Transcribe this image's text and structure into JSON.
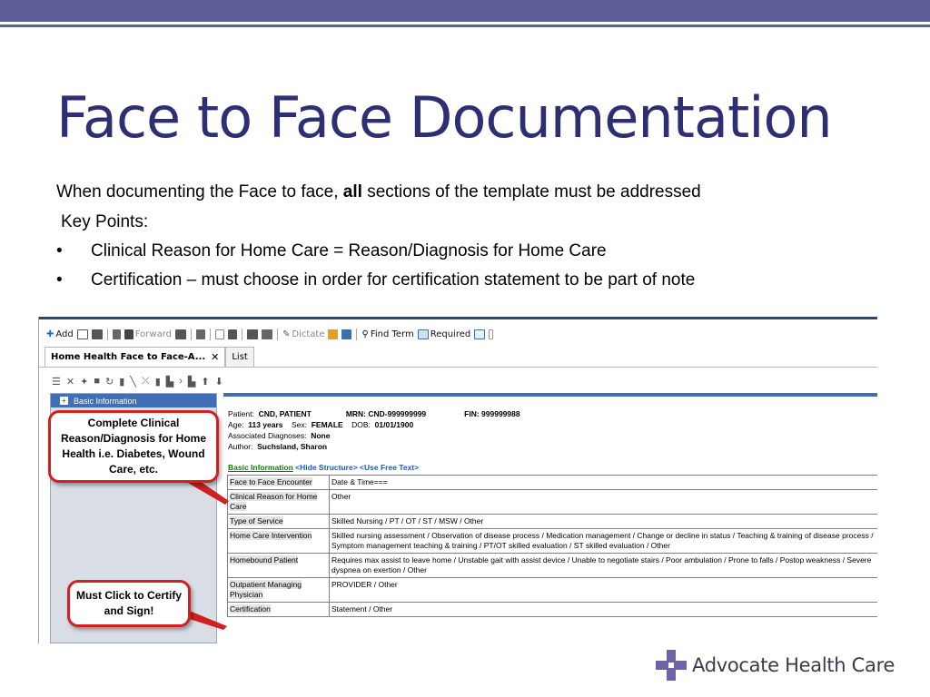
{
  "colors": {
    "band": "#5e5f9a",
    "title": "#2e2f73",
    "callout_border": "#d02020",
    "header_blue": "#3f6fb8",
    "logo_purple": "#6f63a8"
  },
  "slide": {
    "title": "Face to Face Documentation",
    "intro_pre": "When documenting the Face to face, ",
    "intro_bold": "all",
    "intro_post": " sections of the template must be addressed",
    "key_points": "Key Points:",
    "bullets": [
      "Clinical Reason for Home Care = Reason/Diagnosis for Home Care",
      "Certification – must choose in order for certification statement to be part of note"
    ],
    "bullet_char": "•"
  },
  "toolbar": {
    "add": "Add",
    "forward": "Forward",
    "dictate": "Dictate",
    "find_term": "Find Term",
    "required": "Required"
  },
  "tabs": [
    {
      "label": "Home Health Face to Face-A...",
      "close": "✕"
    },
    {
      "label": "List"
    }
  ],
  "left_pane": {
    "header": "Basic Information",
    "expand": "+"
  },
  "patient": {
    "patient_label": "Patient:",
    "patient_value": "CND, PATIENT",
    "mrn": "MRN: CND-999999999",
    "fin": "FIN: 999999988",
    "age_label": "Age:",
    "age_value": "113 years",
    "sex_label": "Sex:",
    "sex_value": "FEMALE",
    "dob_label": "DOB:",
    "dob_value": "01/01/1900",
    "diag_label": "Associated Diagnoses:",
    "diag_value": "None",
    "author_label": "Author:",
    "author_value": "Suchsland, Sharon"
  },
  "basic_line": {
    "basic_info": "Basic Information",
    "hide_structure": "<Hide Structure>",
    "use_free_text": "<Use Free Text>"
  },
  "grid": [
    {
      "label": "Face to Face Encounter",
      "value": "Date & Time==="
    },
    {
      "label": "Clinical Reason for Home Care",
      "value": "Other"
    },
    {
      "label": "Type of Service",
      "value": "Skilled Nursing  /  PT  /  OT  /  ST  /  MSW  /  Other"
    },
    {
      "label": "Home Care Intervention",
      "value": "Skilled nursing assessment  /  Observation of disease process  /  Medication management  /  Change or decline in status  /  Teaching & training of disease process  /  Symptom management teaching & training  /  PT/OT skilled evaluation  /  ST skilled evaluation  /  Other"
    },
    {
      "label": "Homebound Patient",
      "value": "Requires max assist to leave home  /  Unstable gait with assist device  /  Unable to negotiate stairs  /  Poor ambulation  /  Prone to falls  /  Postop weakness  /  Severe dyspnea on exertion  /  Other"
    },
    {
      "label": "Outpatient Managing Physician",
      "value": "PROVIDER  /  Other"
    },
    {
      "label": "Certification",
      "value": "Statement  /  Other"
    }
  ],
  "callouts": [
    "Complete Clinical Reason/Diagnosis for Home Health i.e. Diabetes, Wound Care, etc.",
    "Must Click to Certify and Sign!"
  ],
  "logo": {
    "text": "Advocate Health Care"
  }
}
